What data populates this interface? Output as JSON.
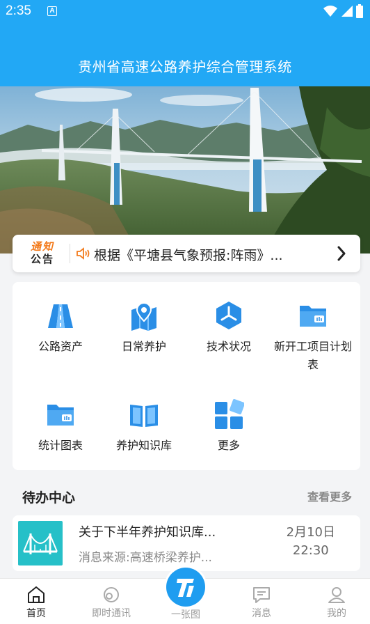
{
  "status_bar": {
    "time": "2:35",
    "badge": "A"
  },
  "header": {
    "title": "贵州省高速公路养护综合管理系统"
  },
  "notice": {
    "logo_line1": "通知",
    "logo_line2": "公告",
    "text": "根据《平塘县气象预报:阵雨》..."
  },
  "menu": {
    "items": [
      {
        "label": "公路资产",
        "icon": "road-icon"
      },
      {
        "label": "日常养护",
        "icon": "map-pin-icon"
      },
      {
        "label": "技术状况",
        "icon": "hexagon-chart-icon"
      },
      {
        "label": "新开工项目计划表",
        "icon": "folder-icon"
      },
      {
        "label": "统计图表",
        "icon": "folder-chart-icon"
      },
      {
        "label": "养护知识库",
        "icon": "book-icon"
      },
      {
        "label": "更多",
        "icon": "grid-icon"
      }
    ]
  },
  "todo": {
    "title": "待办中心",
    "more": "查看更多",
    "items": [
      {
        "title": "关于下半年养护知识库...",
        "source": "消息来源:高速桥梁养护...",
        "date": "2月10日",
        "time": "22:30"
      }
    ]
  },
  "bottom_nav": {
    "items": [
      {
        "label": "首页",
        "icon": "home-icon",
        "active": true
      },
      {
        "label": "即时通讯",
        "icon": "chat-bubble-icon",
        "active": false
      },
      {
        "label": "一张图",
        "icon": "road-logo-icon",
        "active": false
      },
      {
        "label": "消息",
        "icon": "message-icon",
        "active": false
      },
      {
        "label": "我的",
        "icon": "user-icon",
        "active": false
      }
    ]
  },
  "colors": {
    "primary": "#22a8f5",
    "accent_orange": "#f37b1d",
    "icon_blue": "#2a8ee6"
  }
}
